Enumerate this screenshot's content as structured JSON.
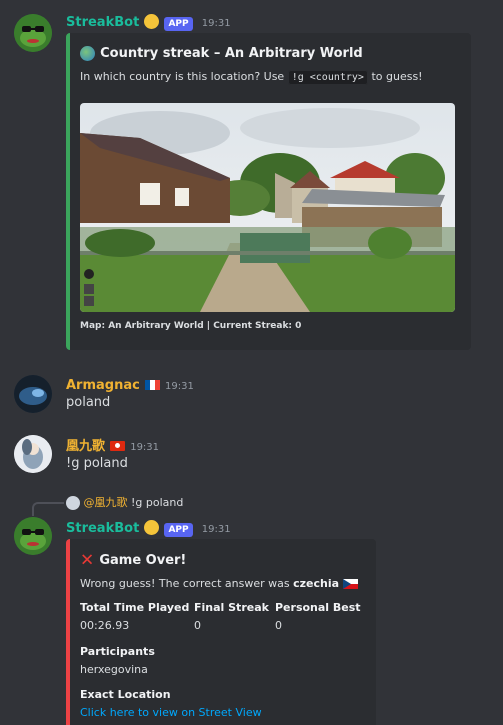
{
  "messages": [
    {
      "username": "StreakBot",
      "app_badge": "APP",
      "time": "19:31",
      "embed": {
        "title": "Country streak – An Arbitrary World",
        "desc_before": "In which country is this location? Use ",
        "code": "!g <country>",
        "desc_after": " to guess!",
        "footer": "Map: An Arbitrary World | Current Streak: 0",
        "accent_color": "#3ba55c"
      }
    },
    {
      "username": "Armagnac",
      "time": "19:31",
      "text": "poland",
      "name_color": "#f0b232",
      "flag": "fr"
    },
    {
      "username": "凰九歌",
      "time": "19:31",
      "text": "!g poland",
      "name_color": "#f0b232",
      "flag": "hk"
    },
    {
      "reply": {
        "username": "@凰九歌",
        "text": "!g poland"
      },
      "username": "StreakBot",
      "app_badge": "APP",
      "time": "19:31",
      "embed": {
        "title": "Game Over!",
        "desc_before": "Wrong guess! The correct answer was ",
        "answer": "czechia",
        "accent_color": "#ed4245",
        "fields": [
          {
            "name": "Total Time Played",
            "value": "00:26.93"
          },
          {
            "name": "Final Streak",
            "value": "0"
          },
          {
            "name": "Personal Best",
            "value": "0"
          }
        ],
        "participants_label": "Participants",
        "participants_value": "herxegovina",
        "exact_location_label": "Exact Location",
        "exact_location_link": "Click here to view on Street View"
      }
    }
  ],
  "colors": {
    "bot_name": "#1abc9c",
    "accent_app": "#5865f2"
  },
  "icons": {
    "globe": "globe-icon",
    "cross": "red-x-icon",
    "france_flag": "flag-fr",
    "hk_flag": "flag-hk",
    "cz_flag": "flag-cz"
  }
}
